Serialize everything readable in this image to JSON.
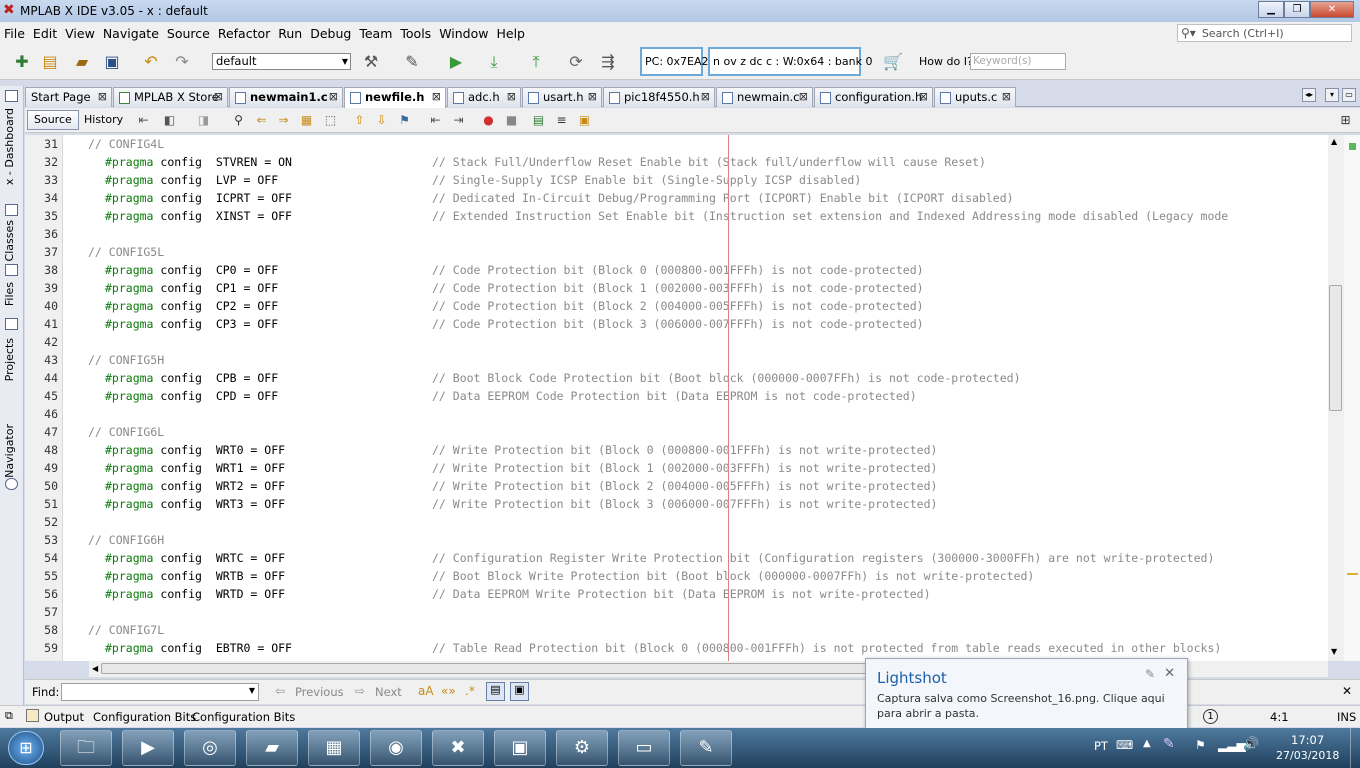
{
  "window": {
    "title": "MPLAB X IDE v3.05 - x : default",
    "app_icon": "mplab-x-icon"
  },
  "menu": [
    "File",
    "Edit",
    "View",
    "Navigate",
    "Source",
    "Refactor",
    "Run",
    "Debug",
    "Team",
    "Tools",
    "Window",
    "Help"
  ],
  "search": {
    "placeholder": "Search (Ctrl+I)"
  },
  "toolbar": {
    "config_value": "default",
    "pc": "PC: 0x7EA2",
    "status": "n ov z dc c  : W:0x64 : bank 0",
    "howdo": "How do I?",
    "keyword_placeholder": "Keyword(s)"
  },
  "sidebar": {
    "tabs": [
      "x - Dashboard",
      "Classes",
      "Files",
      "Projects",
      "Navigator"
    ]
  },
  "tabs": [
    {
      "label": "Start Page",
      "bold": false
    },
    {
      "label": "MPLAB X Store",
      "bold": false
    },
    {
      "label": "newmain1.c",
      "bold": true
    },
    {
      "label": "newfile.h",
      "bold": true,
      "active": true
    },
    {
      "label": "adc.h",
      "bold": false
    },
    {
      "label": "usart.h",
      "bold": false
    },
    {
      "label": "pic18f4550.h",
      "bold": false
    },
    {
      "label": "newmain.c",
      "bold": false
    },
    {
      "label": "configuration.h",
      "bold": false
    },
    {
      "label": "uputs.c",
      "bold": false
    }
  ],
  "editor_tabs": {
    "source": "Source",
    "history": "History"
  },
  "code": [
    {
      "n": "31",
      "section": "// CONFIG4L"
    },
    {
      "n": "32",
      "kw": "#pragma",
      "cfg": "config",
      "setting": "STVREN = ON  ",
      "comment": "// Stack Full/Underflow Reset Enable bit (Stack full/underflow will cause Reset)"
    },
    {
      "n": "33",
      "kw": "#pragma",
      "cfg": "config",
      "setting": "LVP = OFF    ",
      "comment": "// Single-Supply ICSP Enable bit (Single-Supply ICSP disabled)"
    },
    {
      "n": "34",
      "kw": "#pragma",
      "cfg": "config",
      "setting": "ICPRT = OFF  ",
      "comment": "// Dedicated In-Circuit Debug/Programming Port (ICPORT) Enable bit (ICPORT disabled)"
    },
    {
      "n": "35",
      "kw": "#pragma",
      "cfg": "config",
      "setting": "XINST = OFF  ",
      "comment": "// Extended Instruction Set Enable bit (Instruction set extension and Indexed Addressing mode disabled (Legacy mode"
    },
    {
      "n": "36"
    },
    {
      "n": "37",
      "section": "// CONFIG5L"
    },
    {
      "n": "38",
      "kw": "#pragma",
      "cfg": "config",
      "setting": "CP0 = OFF    ",
      "comment": "// Code Protection bit (Block 0 (000800-001FFFh) is not code-protected)"
    },
    {
      "n": "39",
      "kw": "#pragma",
      "cfg": "config",
      "setting": "CP1 = OFF    ",
      "comment": "// Code Protection bit (Block 1 (002000-003FFFh) is not code-protected)"
    },
    {
      "n": "40",
      "kw": "#pragma",
      "cfg": "config",
      "setting": "CP2 = OFF    ",
      "comment": "// Code Protection bit (Block 2 (004000-005FFFh) is not code-protected)"
    },
    {
      "n": "41",
      "kw": "#pragma",
      "cfg": "config",
      "setting": "CP3 = OFF    ",
      "comment": "// Code Protection bit (Block 3 (006000-007FFFh) is not code-protected)"
    },
    {
      "n": "42"
    },
    {
      "n": "43",
      "section": "// CONFIG5H"
    },
    {
      "n": "44",
      "kw": "#pragma",
      "cfg": "config",
      "setting": "CPB = OFF    ",
      "comment": "// Boot Block Code Protection bit (Boot block (000000-0007FFh) is not code-protected)"
    },
    {
      "n": "45",
      "kw": "#pragma",
      "cfg": "config",
      "setting": "CPD = OFF    ",
      "comment": "// Data EEPROM Code Protection bit (Data EEPROM is not code-protected)"
    },
    {
      "n": "46"
    },
    {
      "n": "47",
      "section": "// CONFIG6L"
    },
    {
      "n": "48",
      "kw": "#pragma",
      "cfg": "config",
      "setting": "WRT0 = OFF   ",
      "comment": "// Write Protection bit (Block 0 (000800-001FFFh) is not write-protected)"
    },
    {
      "n": "49",
      "kw": "#pragma",
      "cfg": "config",
      "setting": "WRT1 = OFF   ",
      "comment": "// Write Protection bit (Block 1 (002000-003FFFh) is not write-protected)"
    },
    {
      "n": "50",
      "kw": "#pragma",
      "cfg": "config",
      "setting": "WRT2 = OFF   ",
      "comment": "// Write Protection bit (Block 2 (004000-005FFFh) is not write-protected)"
    },
    {
      "n": "51",
      "kw": "#pragma",
      "cfg": "config",
      "setting": "WRT3 = OFF   ",
      "comment": "// Write Protection bit (Block 3 (006000-007FFFh) is not write-protected)"
    },
    {
      "n": "52"
    },
    {
      "n": "53",
      "section": "// CONFIG6H"
    },
    {
      "n": "54",
      "kw": "#pragma",
      "cfg": "config",
      "setting": "WRTC = OFF   ",
      "comment": "// Configuration Register Write Protection bit (Configuration registers (300000-3000FFh) are not write-protected)"
    },
    {
      "n": "55",
      "kw": "#pragma",
      "cfg": "config",
      "setting": "WRTB = OFF   ",
      "comment": "// Boot Block Write Protection bit (Boot block (000000-0007FFh) is not write-protected)"
    },
    {
      "n": "56",
      "kw": "#pragma",
      "cfg": "config",
      "setting": "WRTD = OFF   ",
      "comment": "// Data EEPROM Write Protection bit (Data EEPROM is not write-protected)"
    },
    {
      "n": "57"
    },
    {
      "n": "58",
      "section": "// CONFIG7L"
    },
    {
      "n": "59",
      "kw": "#pragma",
      "cfg": "config",
      "setting": "EBTR0 = OFF  ",
      "comment": "// Table Read Protection bit (Block 0 (000800-001FFFh) is not protected from table reads executed in other blocks)"
    }
  ],
  "findbar": {
    "label": "Find:",
    "previous": "Previous",
    "next": "Next"
  },
  "output": {
    "tabs": [
      "Output",
      "Configuration Bits",
      "Configuration Bits"
    ],
    "position": "4:1",
    "mode": "INS"
  },
  "notification": {
    "title": "Lightshot",
    "message": "Captura salva como Screenshot_16.png. Clique aqui para abrir a pasta."
  },
  "tray": {
    "lang": "PT",
    "time": "17:07",
    "date": "27/03/2018"
  },
  "colors": {
    "keyword": "#0b7b0b",
    "comment": "#8a8a8a",
    "margin": "#e08080",
    "taskbar": "#20405c"
  }
}
